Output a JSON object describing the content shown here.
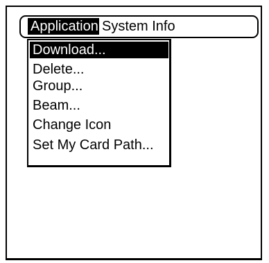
{
  "menubar": {
    "menus": [
      {
        "label": "Application",
        "selected": true
      },
      {
        "label": "System Info",
        "selected": false
      }
    ]
  },
  "dropdown": {
    "items": [
      {
        "label": "Download...",
        "selected": true
      },
      {
        "label": "Delete...",
        "selected": false
      },
      {
        "label": "Group...",
        "selected": false
      },
      {
        "label": "Beam...",
        "selected": false
      },
      {
        "label": "Change Icon",
        "selected": false
      },
      {
        "label": "Set My Card Path...",
        "selected": false
      }
    ]
  },
  "colors": {
    "background": "#ffffff",
    "foreground": "#000000",
    "highlight": "#000000",
    "highlight_text": "#ffffff"
  }
}
